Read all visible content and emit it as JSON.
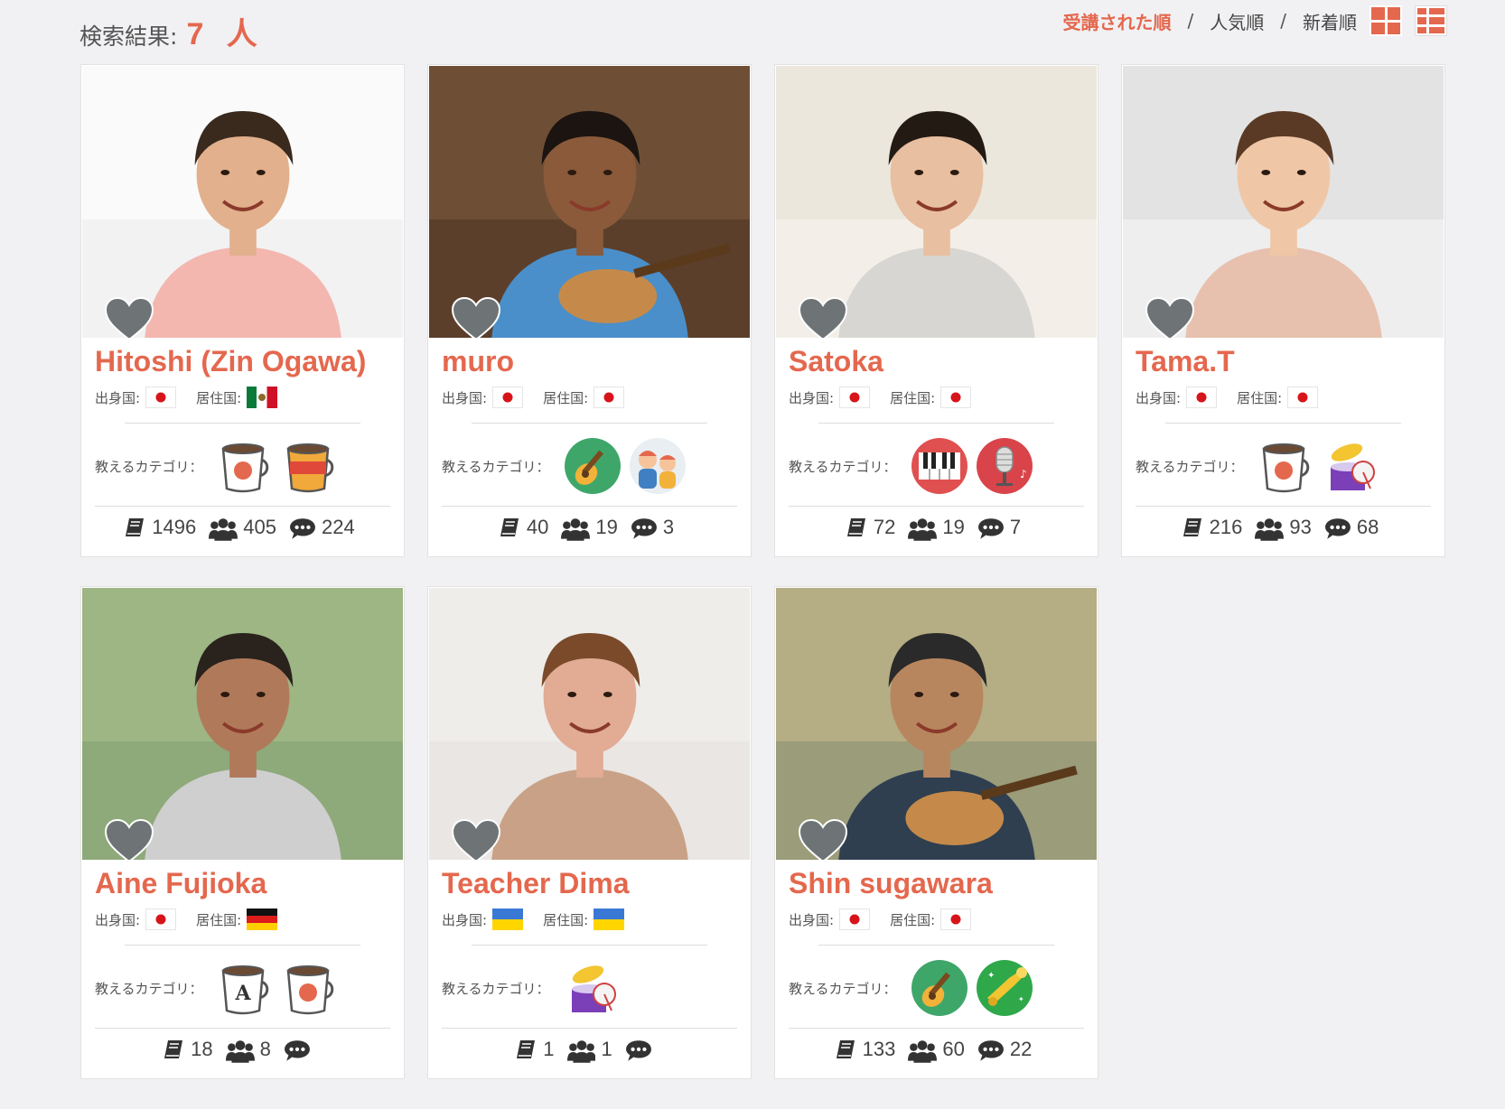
{
  "header": {
    "result_label": "検索結果:",
    "result_count": "7 人",
    "sort_options": [
      "受講された順",
      "人気順",
      "新着順"
    ],
    "sort_active": "受講された順",
    "sort_separator": "/",
    "colors": {
      "accent": "#e4684e",
      "background": "#f1f1f3"
    }
  },
  "labels": {
    "origin": "出身国:",
    "residence": "居住国:",
    "categories": "教えるカテゴリ："
  },
  "teachers": [
    {
      "name": "Hitoshi (Zin Ogawa)",
      "origin_flag": "japan-flag-icon",
      "residence_flag": "mexico-flag-icon",
      "categories": [
        "japanese-tea-cup-icon",
        "spanish-tea-cup-icon"
      ],
      "lessons": "1496",
      "students": "405",
      "reviews": "224"
    },
    {
      "name": "muro",
      "origin_flag": "japan-flag-icon",
      "residence_flag": "japan-flag-icon",
      "categories": [
        "guitar-icon",
        "kids-icon"
      ],
      "lessons": "40",
      "students": "19",
      "reviews": "3"
    },
    {
      "name": "Satoka",
      "origin_flag": "japan-flag-icon",
      "residence_flag": "japan-flag-icon",
      "categories": [
        "piano-icon",
        "microphone-icon"
      ],
      "lessons": "72",
      "students": "19",
      "reviews": "7"
    },
    {
      "name": "Tama.T",
      "origin_flag": "japan-flag-icon",
      "residence_flag": "japan-flag-icon",
      "categories": [
        "japanese-tea-cup-icon",
        "drums-icon"
      ],
      "lessons": "216",
      "students": "93",
      "reviews": "68"
    },
    {
      "name": "Aine Fujioka",
      "origin_flag": "japan-flag-icon",
      "residence_flag": "germany-flag-icon",
      "categories": [
        "english-tea-cup-icon",
        "japanese-tea-cup-icon"
      ],
      "lessons": "18",
      "students": "8",
      "reviews": ""
    },
    {
      "name": "Teacher Dima",
      "origin_flag": "ukraine-flag-icon",
      "residence_flag": "ukraine-flag-icon",
      "categories": [
        "drums-icon"
      ],
      "lessons": "1",
      "students": "1",
      "reviews": ""
    },
    {
      "name": "Shin sugawara",
      "origin_flag": "japan-flag-icon",
      "residence_flag": "japan-flag-icon",
      "categories": [
        "guitar-icon",
        "trumpet-icon"
      ],
      "lessons": "133",
      "students": "60",
      "reviews": "22"
    }
  ]
}
